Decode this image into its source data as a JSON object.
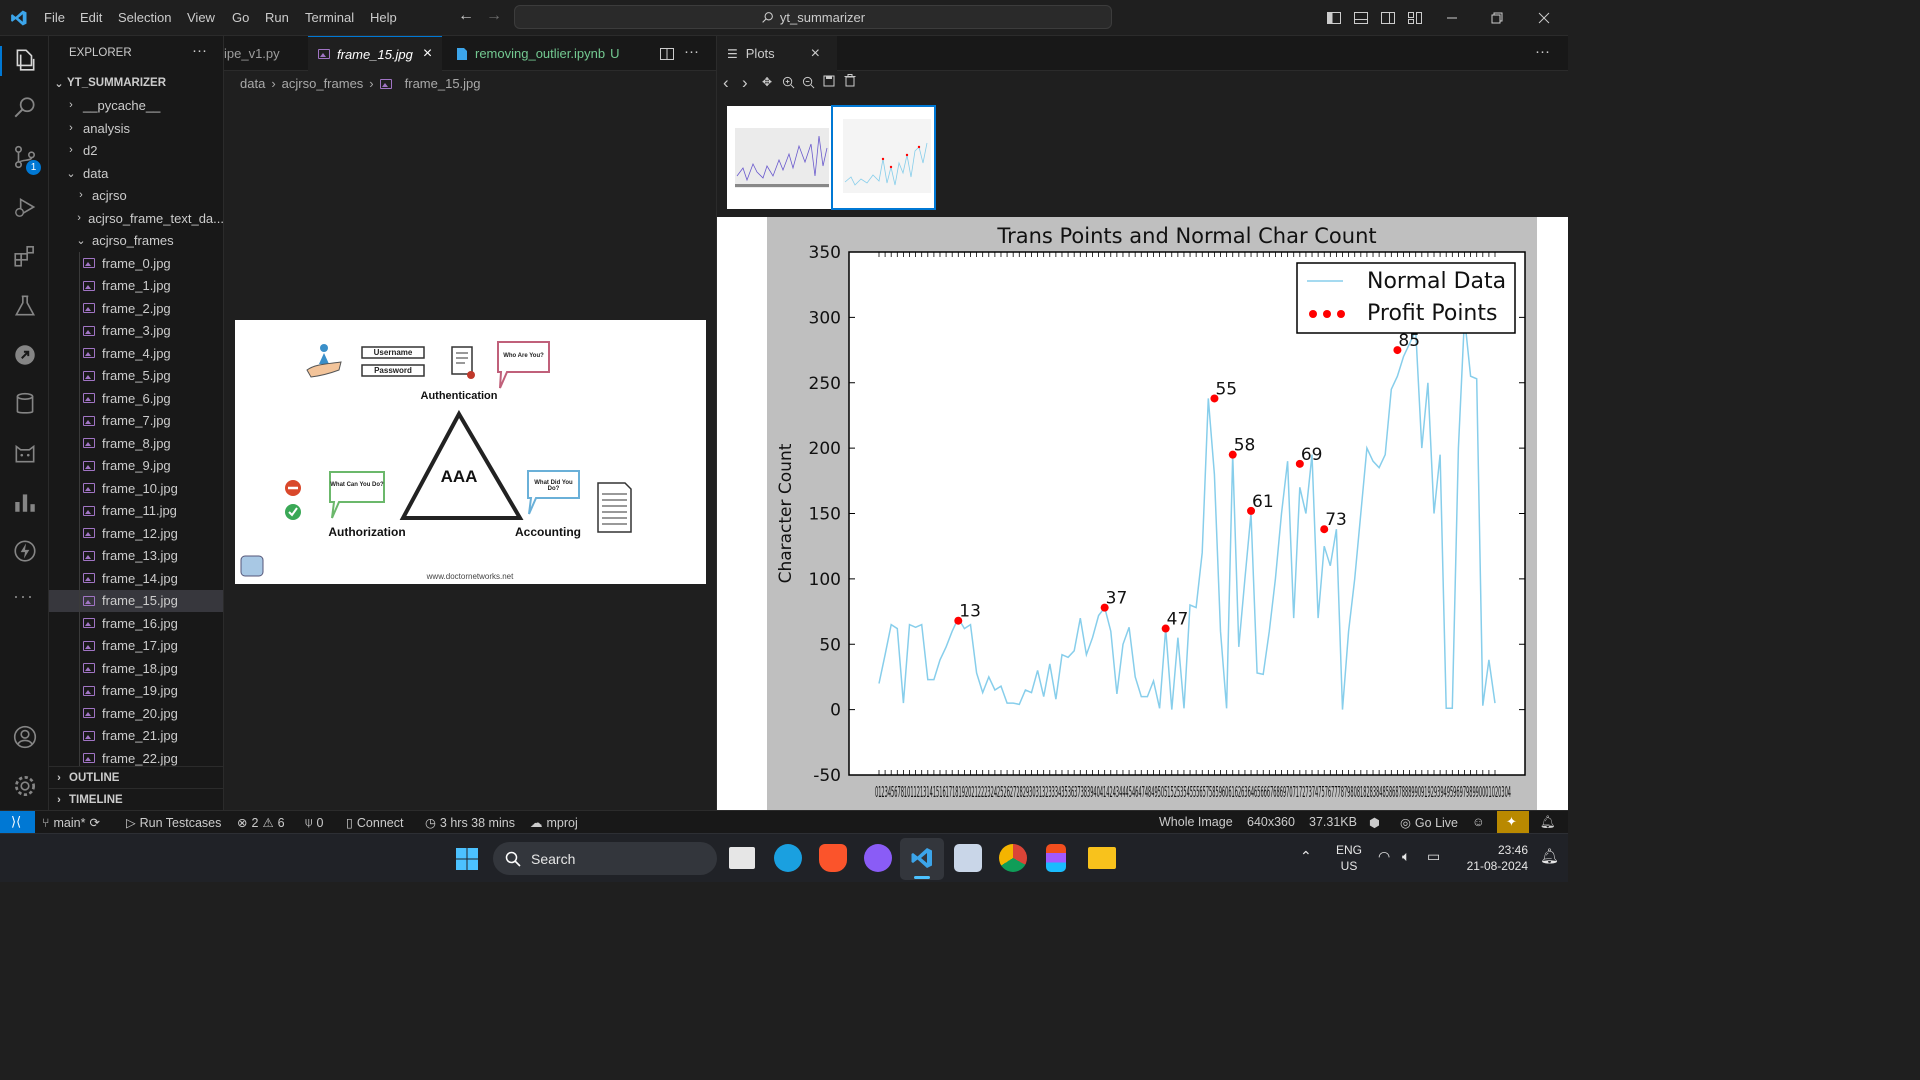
{
  "menu": [
    "File",
    "Edit",
    "Selection",
    "View",
    "Go",
    "Run",
    "Terminal",
    "Help"
  ],
  "search_box": "yt_summarizer",
  "explorer": {
    "title": "EXPLORER",
    "root": "YT_SUMMARIZER",
    "folders": [
      "__pycache__",
      "analysis",
      "d2",
      "data",
      "acjrso",
      "acjrso_frame_text_da...",
      "acjrso_frames"
    ],
    "files": [
      "frame_0.jpg",
      "frame_1.jpg",
      "frame_2.jpg",
      "frame_3.jpg",
      "frame_4.jpg",
      "frame_5.jpg",
      "frame_6.jpg",
      "frame_7.jpg",
      "frame_8.jpg",
      "frame_9.jpg",
      "frame_10.jpg",
      "frame_11.jpg",
      "frame_12.jpg",
      "frame_13.jpg",
      "frame_14.jpg",
      "frame_15.jpg",
      "frame_16.jpg",
      "frame_17.jpg",
      "frame_18.jpg",
      "frame_19.jpg",
      "frame_20.jpg",
      "frame_21.jpg",
      "frame_22.jpg"
    ],
    "selected": "frame_15.jpg",
    "outline": "OUTLINE",
    "timeline": "TIMELINE",
    "scm_badge": "1"
  },
  "tabs": {
    "tab1": "ipe_v1.py",
    "tab2": "frame_15.jpg",
    "tab3": "removing_outlier.ipynb",
    "tab3_status": "U",
    "close": "×"
  },
  "breadcrumb": [
    "data",
    "acjrso_frames",
    "frame_15.jpg"
  ],
  "frame_image": {
    "username": "Username",
    "password": "Password",
    "authentication": "Authentication",
    "who_are_you": "Who Are You?",
    "center": "AAA",
    "what_can_you_do": "What Can You Do?",
    "what_did_you_do": "What Did You Do?",
    "authorization": "Authorization",
    "accounting": "Accounting",
    "website": "www.doctornetworks.net"
  },
  "plots": {
    "tab_label": "Plots",
    "close": "×"
  },
  "chart_data": {
    "type": "line",
    "title": "Trans Points and Normal Char Count",
    "ylabel": "Character Count",
    "xlabel": "",
    "ylim": [
      -50,
      350
    ],
    "yticks": [
      -50,
      0,
      50,
      100,
      150,
      200,
      250,
      300,
      350
    ],
    "x_tick_labels": "012345678101121314151617181920212223242526272829303132333435363738394041424344454647484950515253545556575859606162636465666768697071727374757677787980818283848586878889909192939495969798990001020304",
    "legend_position": "upper-right",
    "series": [
      {
        "name": "Normal Data",
        "color": "#87ceeb",
        "values": [
          20,
          42,
          65,
          62,
          5,
          65,
          63,
          65,
          23,
          23,
          38,
          48,
          60,
          70,
          62,
          65,
          28,
          13,
          25,
          15,
          18,
          5,
          5,
          4,
          15,
          13,
          30,
          10,
          35,
          8,
          42,
          40,
          45,
          70,
          42,
          55,
          72,
          78,
          60,
          12,
          50,
          63,
          25,
          10,
          10,
          22,
          1,
          62,
          0,
          55,
          1,
          80,
          78,
          120,
          238,
          180,
          60,
          1,
          195,
          48,
          100,
          150,
          28,
          27,
          60,
          100,
          150,
          190,
          70,
          170,
          150,
          195,
          70,
          125,
          110,
          138,
          0,
          60,
          100,
          150,
          200,
          190,
          185,
          195,
          245,
          255,
          270,
          280,
          290,
          200,
          250,
          150,
          195,
          1,
          1,
          200,
          300,
          255,
          253,
          3,
          38,
          5
        ]
      },
      {
        "name": "Profit Points",
        "color": "#ff0000",
        "type": "scatter",
        "points": [
          {
            "x": 13,
            "y": 68,
            "label": "13"
          },
          {
            "x": 37,
            "y": 78,
            "label": "37"
          },
          {
            "x": 47,
            "y": 62,
            "label": "47"
          },
          {
            "x": 55,
            "y": 238,
            "label": "55"
          },
          {
            "x": 58,
            "y": 195,
            "label": "58"
          },
          {
            "x": 61,
            "y": 152,
            "label": "61"
          },
          {
            "x": 69,
            "y": 188,
            "label": "69"
          },
          {
            "x": 73,
            "y": 138,
            "label": "73"
          },
          {
            "x": 85,
            "y": 275,
            "label": "85"
          }
        ]
      }
    ]
  },
  "status": {
    "branch": "main*",
    "run_testcases": "Run Testcases",
    "errors": "2",
    "warnings": "6",
    "ports": "0",
    "connect": "Connect",
    "time": "3 hrs 38 mins",
    "project": "mproj",
    "whole_image": "Whole Image",
    "dims": "640x360",
    "size": "37.31KB",
    "go_live": "Go Live"
  },
  "taskbar": {
    "search": "Search",
    "lang1": "ENG",
    "lang2": "US",
    "clock_time": "23:46",
    "clock_date": "21-08-2024"
  }
}
